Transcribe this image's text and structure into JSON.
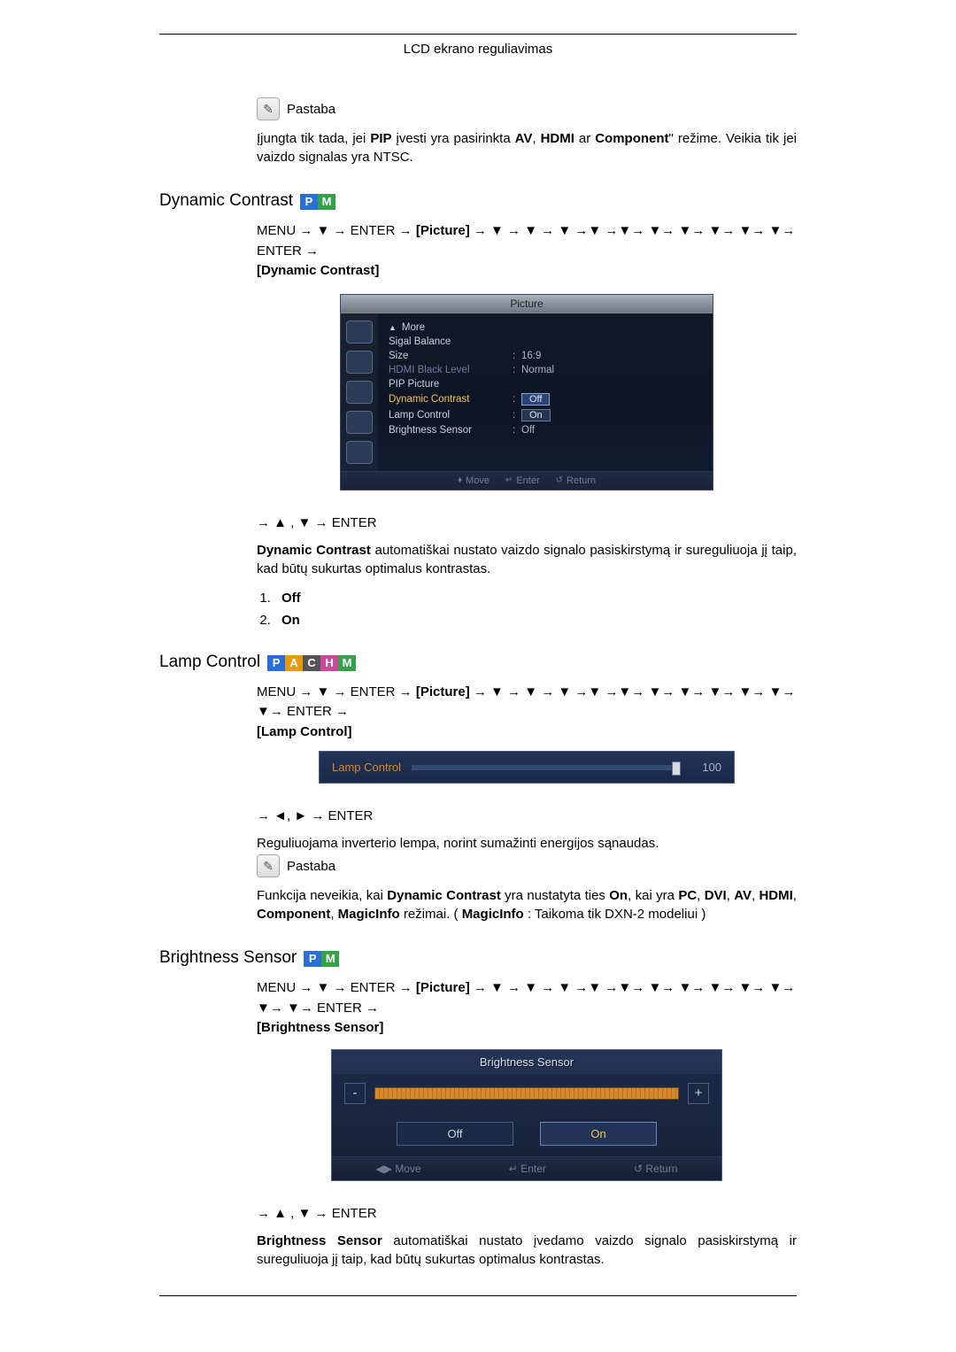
{
  "page": {
    "header": "LCD ekrano reguliavimas"
  },
  "note1": {
    "label": "Pastaba",
    "text_parts": [
      "Įjungta tik tada, jei ",
      "PIP",
      " įvesti yra pasirinkta ",
      "AV",
      ", ",
      "HDMI",
      " ar ",
      "Component",
      "\" režime. Veikia tik jei vaizdo signalas yra NTSC."
    ]
  },
  "dc": {
    "title": "Dynamic Contrast",
    "badges": [
      "P",
      "M"
    ],
    "nav1_prefix": "MENU → ▼ → ENTER →",
    "nav1_bracket": "[Picture]",
    "nav1_mid": "→ ▼ → ▼ → ▼ →▼ →▼→ ▼→ ▼→ ▼→ ▼→ ▼→ ENTER →",
    "nav1_end": "[Dynamic Contrast]",
    "osd": {
      "title": "Picture",
      "rows": {
        "more": "More",
        "sigal": "Sigal Balance",
        "size_label": "Size",
        "size_value": "16:9",
        "hdmi_label": "HDMI Black Level",
        "hdmi_value": "Normal",
        "pip": "PIP Picture",
        "dc_label": "Dynamic Contrast",
        "dc_value": "Off",
        "lamp_label": "Lamp Control",
        "lamp_value": "On",
        "bs_label": "Brightness Sensor",
        "bs_value": "Off"
      },
      "footer": {
        "move": "Move",
        "enter": "Enter",
        "ret": "Return"
      }
    },
    "nav2": "→ ▲ , ▼ → ENTER",
    "desc_parts": [
      "Dynamic Contrast",
      " automatiškai nustato vaizdo signalo pasiskirstymą ir sureguliuoja jį taip, kad būtų sukurtas optimalus kontrastas."
    ],
    "opts": [
      "Off",
      "On"
    ]
  },
  "lamp": {
    "title": "Lamp Control",
    "badges": [
      "P",
      "A",
      "C",
      "H",
      "M"
    ],
    "nav1_prefix": "MENU → ▼ → ENTER →",
    "nav1_bracket": "[Picture]",
    "nav1_mid": "→ ▼ → ▼ → ▼ →▼ →▼→ ▼→ ▼→ ▼→ ▼→ ▼→ ▼→ ENTER →",
    "nav1_end": "[Lamp Control]",
    "osd": {
      "label": "Lamp Control",
      "value": "100"
    },
    "nav2": "→ ◄, ► → ENTER",
    "desc": "Reguliuojama inverterio lempa, norint sumažinti energijos sąnaudas.",
    "note_label": "Pastaba",
    "note_parts": [
      "Funkcija neveikia, kai ",
      "Dynamic Contrast",
      " yra nustatyta ties ",
      "On",
      ", kai yra ",
      "PC",
      ", ",
      "DVI",
      ", ",
      "AV",
      ", ",
      "HDMI",
      ", ",
      "Component",
      ", ",
      "MagicInfo",
      " režimai. ( ",
      "MagicInfo",
      " : Taikoma tik DXN-2 modeliui )"
    ]
  },
  "bs": {
    "title": "Brightness Sensor",
    "badges": [
      "P",
      "M"
    ],
    "nav1_prefix": "MENU → ▼ → ENTER →",
    "nav1_bracket": "[Picture]",
    "nav1_mid": "→ ▼ → ▼ → ▼ →▼ →▼→ ▼→ ▼→ ▼→ ▼→ ▼→ ▼→ ▼→ ENTER →",
    "nav1_end": "[Brightness Sensor]",
    "osd": {
      "title": "Brightness Sensor",
      "minus": "-",
      "plus": "+",
      "off": "Off",
      "on": "On",
      "footer": {
        "move": "Move",
        "enter": "Enter",
        "ret": "Return"
      }
    },
    "nav2": "→ ▲ , ▼ → ENTER",
    "desc_parts": [
      "Brightness Sensor",
      "  automatiškai nustato įvedamo vaizdo signalo pasiskirstymą ir sureguliuoja jį taip, kad būtų sukurtas optimalus kontrastas."
    ]
  }
}
